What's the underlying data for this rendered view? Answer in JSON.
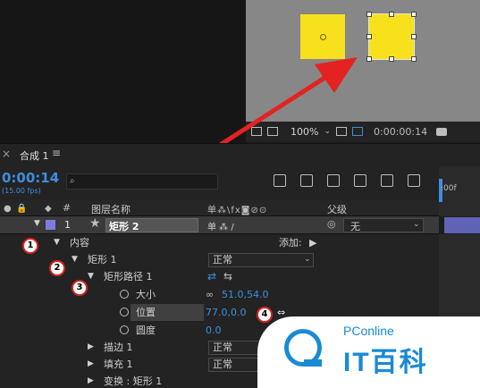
{
  "viewer": {
    "zoom": "100%",
    "timecode": "0:00:00:14"
  },
  "timeline": {
    "tab_label": "合成 1",
    "menu_glyph": "≡",
    "close_glyph": "×",
    "timecode": "0:00:14",
    "fps": "(15.00 fps)",
    "search_glyph": "⌕",
    "ruler_label": ":00f"
  },
  "columns": {
    "number": "#",
    "name": "图层名称",
    "switches": "单⁂\\fx◙⊘⊙",
    "parent": "父级"
  },
  "layer": {
    "number": "1",
    "star": "★",
    "name": "矩形 2",
    "switches": "单 ⁂ /",
    "parent_value": "无",
    "parent_icon": "◎"
  },
  "properties": {
    "contents": "内容",
    "add_label": "添加:",
    "rect_group": "矩形 1",
    "rect_group_mode": "正常",
    "rect_path": "矩形路径 1",
    "size_label": "大小",
    "size_value": "51.0,54.0",
    "position_label": "位置",
    "position_value": "77.0,0.0",
    "roundness_label": "圆度",
    "roundness_value": "0.0",
    "stroke": "描边 1",
    "stroke_mode": "正常",
    "fill": "填充 1",
    "fill_mode": "正常",
    "transform": "变换 : 矩形 1"
  },
  "badges": [
    "1",
    "2",
    "3",
    "4"
  ],
  "watermark": {
    "brand": "PConline",
    "title": "IT百科"
  },
  "colors": {
    "accent_blue": "#3c8fdf",
    "shape_yellow": "#f7e11d",
    "arrow_red": "#e52222",
    "layer_label": "#7d7de0"
  }
}
